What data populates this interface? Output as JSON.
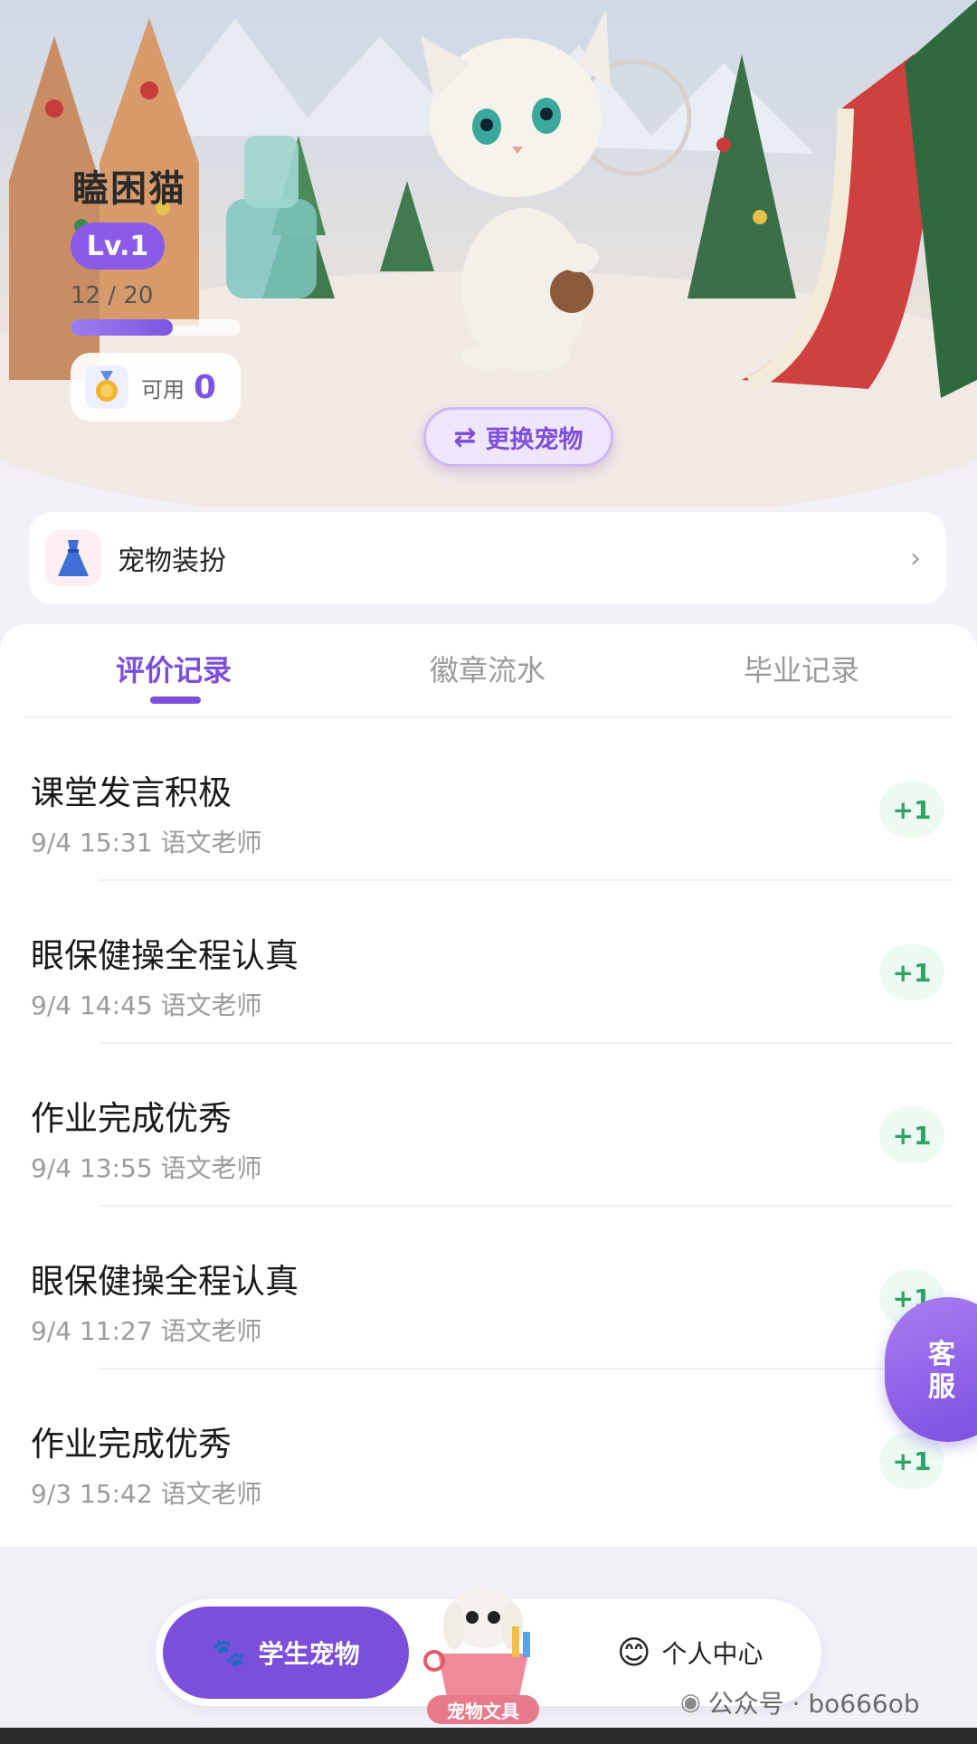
{
  "hero": {
    "pet_name": "瞌困猫",
    "level": "Lv.1",
    "xp_text": "12 / 20",
    "xp_fraction": 0.6,
    "points_label": "可用",
    "points_value": "0",
    "swap_label": "更换宠物"
  },
  "dress": {
    "label": "宠物装扮"
  },
  "tabs": [
    {
      "label": "评价记录"
    },
    {
      "label": "徽章流水"
    },
    {
      "label": "毕业记录"
    }
  ],
  "records": [
    {
      "title": "课堂发言积极",
      "meta": "9/4 15:31 语文老师",
      "badge": "+1"
    },
    {
      "title": "眼保健操全程认真",
      "meta": "9/4 14:45 语文老师",
      "badge": "+1"
    },
    {
      "title": "作业完成优秀",
      "meta": "9/4 13:55 语文老师",
      "badge": "+1"
    },
    {
      "title": "眼保健操全程认真",
      "meta": "9/4 11:27 语文老师",
      "badge": "+1"
    },
    {
      "title": "作业完成优秀",
      "meta": "9/3 15:42 语文老师",
      "badge": "+1"
    }
  ],
  "service": {
    "line1": "客",
    "line2": "服"
  },
  "nav": {
    "pet": "学生宠物",
    "center": "宠物文具",
    "me": "个人中心"
  },
  "watermark": "公众号 · bo666ob",
  "colors": {
    "accent": "#7b4fd9",
    "positive": "#2fa268"
  },
  "icons": {
    "medal": "medal-icon",
    "dress": "dress-icon",
    "swap": "swap-icon",
    "paw": "paw-icon",
    "smile": "smile-icon"
  }
}
